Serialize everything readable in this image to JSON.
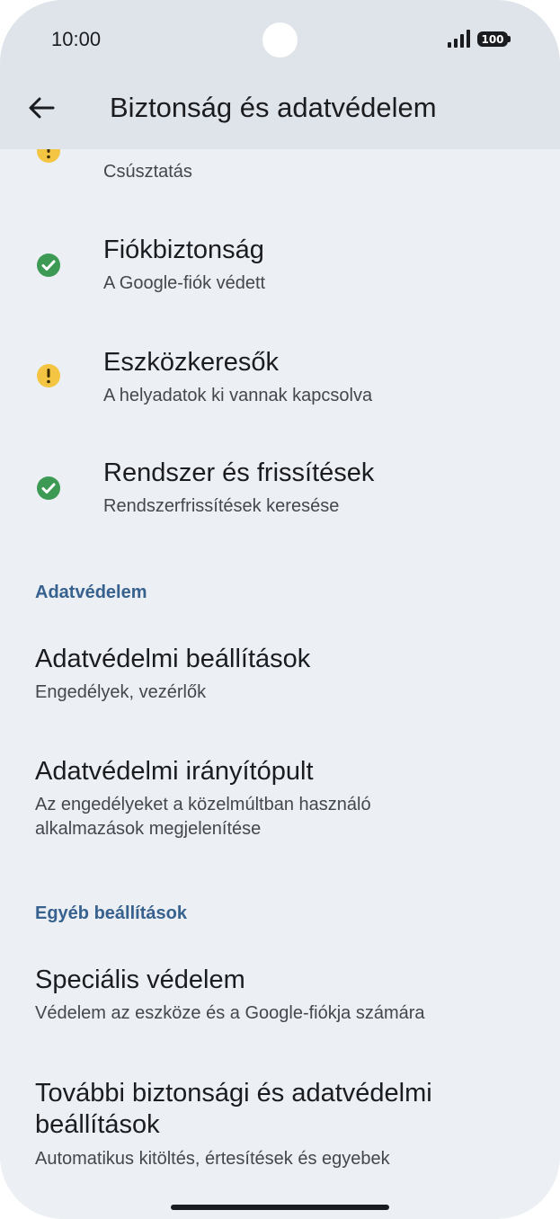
{
  "status_bar": {
    "time": "10:00",
    "battery": "100"
  },
  "header": {
    "title": "Biztonság és adatvédelem"
  },
  "security_items": [
    {
      "title": "",
      "subtitle": "Csúsztatás",
      "status": "warning"
    },
    {
      "title": "Fiókbiztonság",
      "subtitle": "A Google-fiók védett",
      "status": "ok"
    },
    {
      "title": "Eszközkeresők",
      "subtitle": "A helyadatok ki vannak kapcsolva",
      "status": "warning"
    },
    {
      "title": "Rendszer és frissítések",
      "subtitle": "Rendszerfrissítések keresése",
      "status": "ok"
    }
  ],
  "privacy": {
    "heading": "Adatvédelem",
    "items": [
      {
        "title": "Adatvédelmi beállítások",
        "subtitle": "Engedélyek, vezérlők"
      },
      {
        "title": "Adatvédelmi irányítópult",
        "subtitle_line1": "Az engedélyeket a közelmúltban használó",
        "subtitle_line2": "alkalmazások megjelenítése"
      }
    ]
  },
  "other": {
    "heading": "Egyéb beállítások",
    "items": [
      {
        "title": "Speciális védelem",
        "subtitle": "Védelem az eszköze és a Google-fiókja számára"
      },
      {
        "title_line1": "További biztonsági és adatvédelmi",
        "title_line2": "beállítások",
        "subtitle": "Automatikus kitöltés, értesítések és egyebek"
      }
    ]
  },
  "colors": {
    "warning": "#f4c542",
    "ok": "#3c9a55",
    "accent": "#37618e",
    "header_bg": "#dfe4ea",
    "page_bg": "#eceff3"
  }
}
